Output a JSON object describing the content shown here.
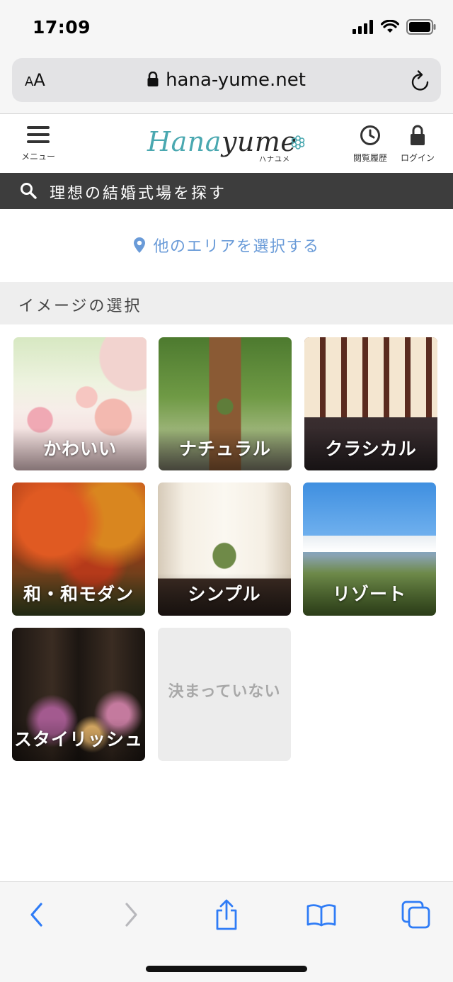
{
  "status_bar": {
    "time": "17:09"
  },
  "browser": {
    "text_size_button": "AA",
    "url": "hana-yume.net"
  },
  "header": {
    "menu_label": "メニュー",
    "logo": {
      "part1": "Hana",
      "part2": "yume",
      "kana": "ハナユメ"
    },
    "history_label": "閲覧履歴",
    "login_label": "ログイン"
  },
  "search": {
    "text": "理想の結婚式場を探す"
  },
  "area": {
    "link_text": "他のエリアを選択する"
  },
  "section": {
    "title": "イメージの選択"
  },
  "tiles": [
    {
      "label": "かわいい"
    },
    {
      "label": "ナチュラル"
    },
    {
      "label": "クラシカル"
    },
    {
      "label": "和・和モダン"
    },
    {
      "label": "シンプル"
    },
    {
      "label": "リゾート"
    },
    {
      "label": "スタイリッシュ"
    },
    {
      "label": "決まっていない"
    }
  ],
  "colors": {
    "accent_link": "#6a9bd8",
    "search_bar_bg": "#3d3d3d",
    "logo_teal": "#4aa8b0",
    "ios_blue": "#2f7cf6"
  }
}
